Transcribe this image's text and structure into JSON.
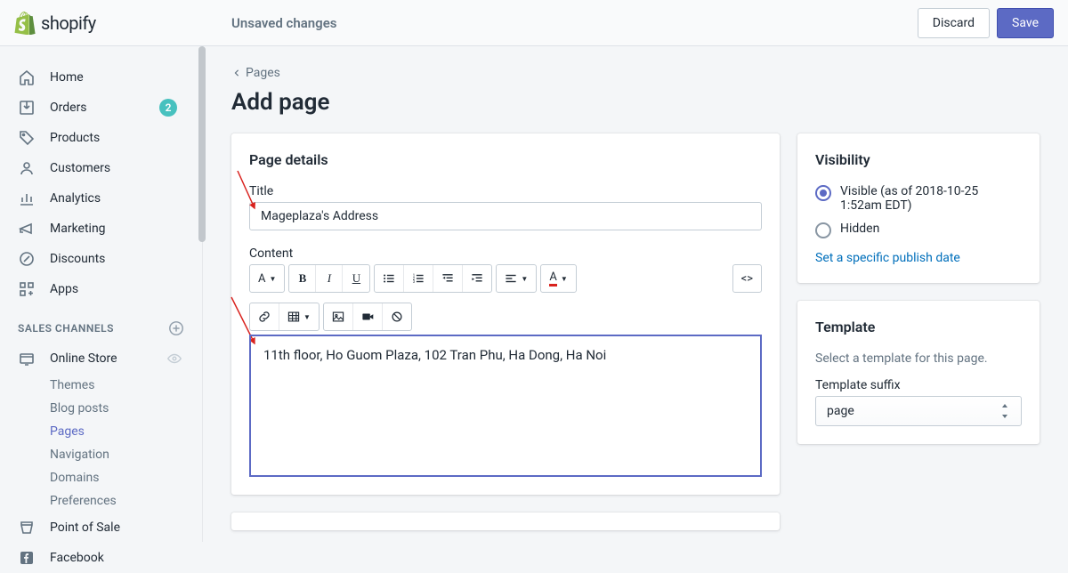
{
  "topbar": {
    "brand": "shopify",
    "unsaved": "Unsaved changes",
    "discard": "Discard",
    "save": "Save"
  },
  "sidebar": {
    "items": [
      {
        "label": "Home"
      },
      {
        "label": "Orders",
        "badge": "2"
      },
      {
        "label": "Products"
      },
      {
        "label": "Customers"
      },
      {
        "label": "Analytics"
      },
      {
        "label": "Marketing"
      },
      {
        "label": "Discounts"
      },
      {
        "label": "Apps"
      }
    ],
    "section_label": "SALES CHANNELS",
    "channels": [
      {
        "label": "Online Store",
        "sub": [
          {
            "label": "Themes"
          },
          {
            "label": "Blog posts"
          },
          {
            "label": "Pages",
            "active": true
          },
          {
            "label": "Navigation"
          },
          {
            "label": "Domains"
          },
          {
            "label": "Preferences"
          }
        ]
      },
      {
        "label": "Point of Sale"
      },
      {
        "label": "Facebook"
      }
    ]
  },
  "breadcrumb": {
    "label": "Pages"
  },
  "page_title": "Add page",
  "details": {
    "heading": "Page details",
    "title_label": "Title",
    "title_value": "Mageplaza's Address",
    "content_label": "Content",
    "toolbar_font_label": "A",
    "content_value": "11th floor, Ho Guom Plaza, 102 Tran Phu, Ha Dong, Ha Noi"
  },
  "visibility": {
    "heading": "Visibility",
    "visible_label": "Visible (as of 2018-10-25 1:52am EDT)",
    "hidden_label": "Hidden",
    "publish_link": "Set a specific publish date"
  },
  "template": {
    "heading": "Template",
    "description": "Select a template for this page.",
    "suffix_label": "Template suffix",
    "suffix_value": "page"
  }
}
